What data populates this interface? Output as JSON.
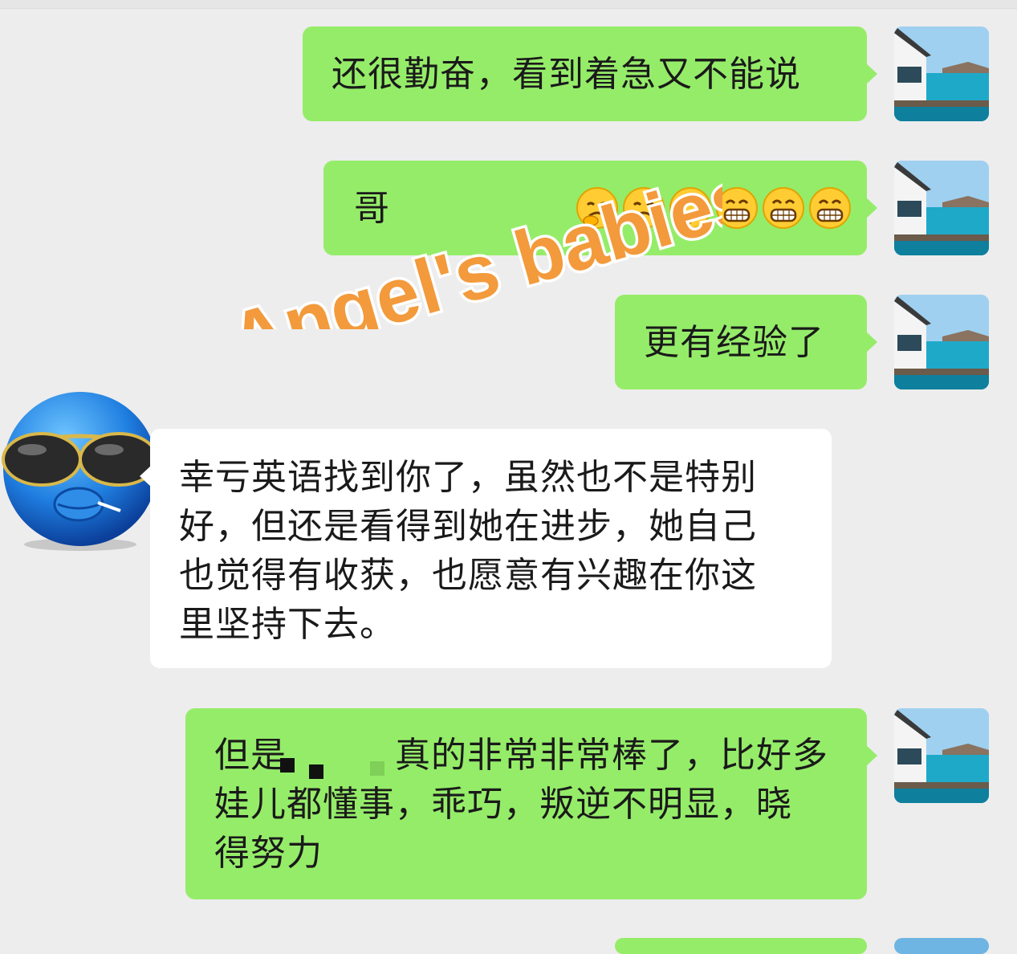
{
  "messages": [
    {
      "id": "m1",
      "side": "out",
      "text": "还很勤奋，看到着急又不能说"
    },
    {
      "id": "m2",
      "side": "out",
      "text": "哥",
      "emoji": [
        "face-holding-back-tears-icon",
        "face-holding-back-tears-icon",
        "face-holding-back-tears-icon",
        "grinning-face-icon",
        "grinning-face-icon",
        "grinning-face-icon"
      ]
    },
    {
      "id": "m3",
      "side": "out",
      "text": "更有经验了"
    },
    {
      "id": "m4",
      "side": "in",
      "lines": [
        "幸亏英语找到你了，虽然也不是特别",
        "好，但还是看得到她在进步，她自己",
        "也觉得有收获，也愿意有兴趣在你这",
        "里坚持下去。"
      ]
    },
    {
      "id": "m5",
      "side": "out",
      "lines": [
        "但是　　　真的非常非常棒了，比好多",
        "娃儿都懂事，乖巧，叛逆不明显，晓",
        "得努力"
      ]
    }
  ],
  "watermark": {
    "text": "Angel's babies",
    "color": "#f39a3c"
  },
  "colors": {
    "background": "#ededed",
    "outgoing_bubble": "#95ec69",
    "incoming_bubble": "#ffffff",
    "text": "#1a1a1a"
  }
}
